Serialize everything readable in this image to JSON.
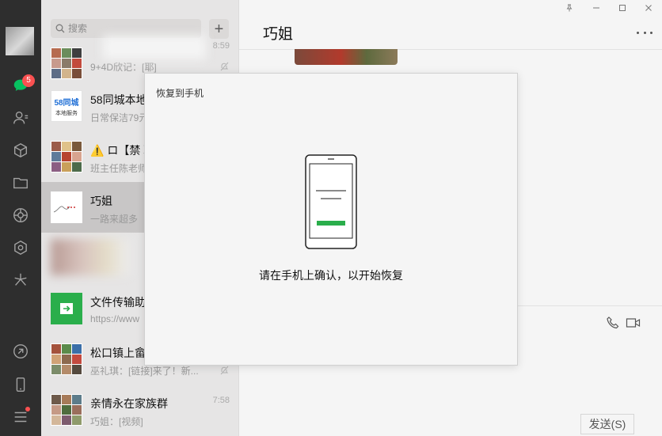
{
  "rail": {
    "chat_badge": "5",
    "icons": [
      "chat-icon",
      "contacts-icon",
      "cube-icon",
      "folder-icon",
      "moments-icon",
      "mini-program-icon",
      "search-spark-icon",
      "link-icon",
      "phone-icon",
      "menu-icon"
    ]
  },
  "search": {
    "placeholder": "搜索"
  },
  "chats": [
    {
      "name": "",
      "preview": "9+4D欣记：[耶]",
      "time": "8:59",
      "muted": true
    },
    {
      "name": "58同城本地",
      "preview": "日常保洁79元",
      "time": "",
      "muted": false,
      "logo_top": "58同城",
      "logo_bottom": "本地服务"
    },
    {
      "name": "⚠️ ロ【禁 聊",
      "preview": "班主任陈老师",
      "time": "",
      "muted": false
    },
    {
      "name": "巧姐",
      "preview": "一路来超多",
      "time": "",
      "muted": false,
      "active": true
    },
    {
      "name": "",
      "preview": "",
      "time": "",
      "muted": false
    },
    {
      "name": "文件传输助",
      "preview": "https://www",
      "time": "",
      "muted": false
    },
    {
      "name": "松口镇上畲",
      "preview": "巫礼琪：[链接]来了！新...",
      "time": "",
      "muted": true
    },
    {
      "name": "亲情永在家族群",
      "preview": "巧姐：[视频]",
      "time": "7:58",
      "muted": false
    }
  ],
  "chat": {
    "title": "巧姐",
    "send_label": "发送(S)"
  },
  "modal": {
    "title": "恢复到手机",
    "message": "请在手机上确认，以开始恢复"
  },
  "colors": {
    "accent_green": "#07c160",
    "file_green": "#2aae4b",
    "badge_red": "#fa5151",
    "rail_bg": "#2e2e2e"
  }
}
